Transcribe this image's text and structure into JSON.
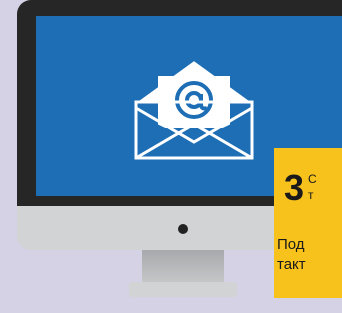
{
  "colors": {
    "background": "#d5d2e5",
    "bezel": "#262626",
    "screen": "#1d6eb5",
    "frame": "#d2d3d5",
    "envelope": "#ffffff",
    "tip_box": "#f7c21c"
  },
  "screen": {
    "icon": "email-envelope-icon"
  },
  "tip": {
    "number": "3",
    "line_1": "С",
    "line_2": "т",
    "line_3": "Под",
    "line_4": "такт"
  }
}
